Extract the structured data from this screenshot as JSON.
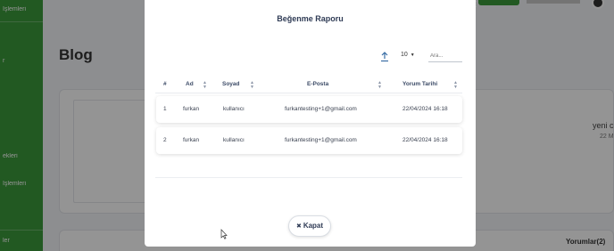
{
  "background": {
    "sidebar": {
      "items": [
        "İşlemleri",
        "r",
        "",
        "",
        "ekleri",
        "İşlemleri",
        "ler"
      ]
    },
    "page_title": "Blog",
    "right_name": "yeni c",
    "right_sub": "22 M",
    "comments_label": "Yorumlar(2)"
  },
  "modal": {
    "title": "Beğenme Raporu",
    "page_size": "10",
    "search_placeholder": "Ara...",
    "columns": [
      "#",
      "Ad",
      "Soyad",
      "E-Posta",
      "Yorum Tarihi"
    ],
    "rows": [
      {
        "index": "1",
        "ad": "furkan",
        "soyad": "kullanıcı",
        "eposta": "furkantesting+1@gmail.com",
        "tarih": "22/04/2024 16:18"
      },
      {
        "index": "2",
        "ad": "furkan",
        "soyad": "kullanıcı",
        "eposta": "furkantesting+1@gmail.com",
        "tarih": "22/04/2024 16:18"
      }
    ],
    "close_label": "Kapat"
  },
  "colors": {
    "accent_green": "#3c9a3c",
    "title_navy": "#2f3b55",
    "export_blue": "#3a6ea5"
  }
}
